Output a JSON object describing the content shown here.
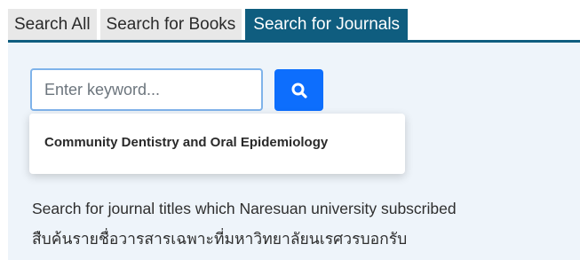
{
  "tabs": [
    {
      "label": "Search All",
      "active": false
    },
    {
      "label": "Search for Books",
      "active": false
    },
    {
      "label": "Search for Journals",
      "active": true
    }
  ],
  "search": {
    "placeholder": "Enter keyword...",
    "value": "",
    "button_icon": "search-icon"
  },
  "suggestions": [
    {
      "label": "Community Dentistry and Oral Epidemiology"
    }
  ],
  "description": {
    "line1": "Search for journal titles which Naresuan university subscribed",
    "line2": "สืบค้นรายชื่อวารสารเฉพาะที่มหาวิทยาลัยนเรศวรบอกรับ"
  },
  "colors": {
    "tab_active": "#0f5d7f",
    "tab_inactive": "#e8e8e8",
    "panel_bg": "#eef4fa",
    "button": "#0d6efd",
    "input_border": "#7fb3ea"
  }
}
